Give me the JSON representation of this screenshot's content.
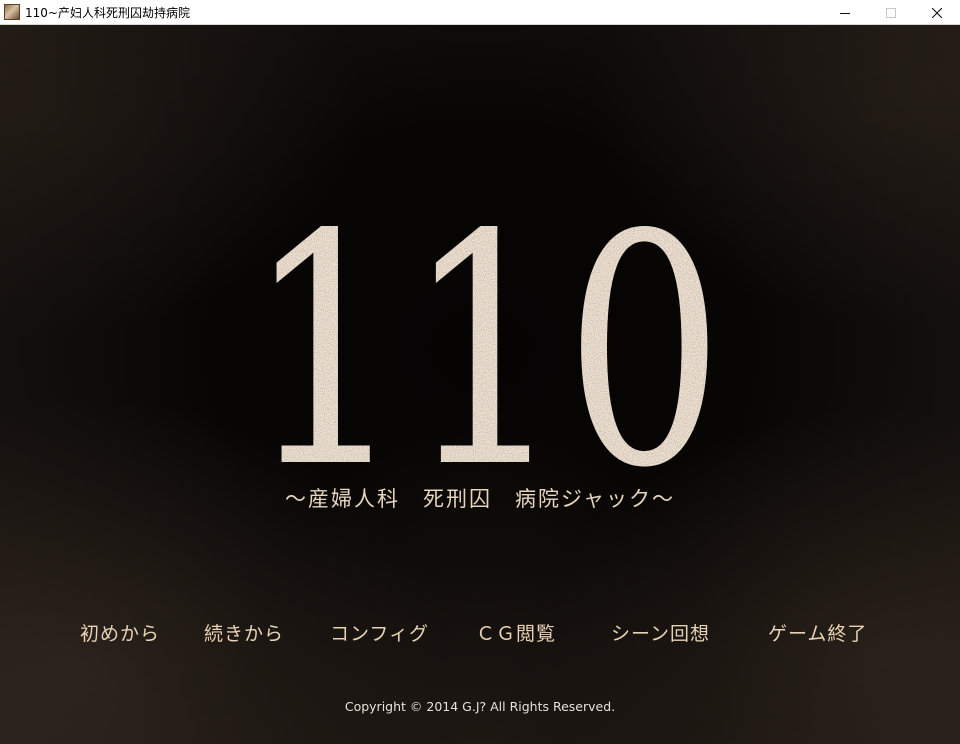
{
  "window": {
    "title": "110~产妇人科死刑囚劫持病院",
    "controls": {
      "minimize": "—",
      "maximize": "□",
      "close": "✕"
    }
  },
  "game": {
    "logo_text": "110",
    "subtitle": "～産婦人科　死刑囚　病院ジャック～",
    "menu": [
      {
        "label": "初めから"
      },
      {
        "label": "続きから"
      },
      {
        "label": "コンフィグ"
      },
      {
        "label": "ＣＧ閲覧"
      },
      {
        "label": "シーン回想"
      },
      {
        "label": "ゲーム終了"
      }
    ],
    "copyright": "Copyright © 2014 G.J? All Rights Reserved."
  },
  "colors": {
    "background": "#0b0908",
    "logo": "#ece4d8",
    "logo_stain": "#8a6a4a",
    "menu_text": "#e8d2b4",
    "subtitle_text": "#e6d6bd",
    "copyright_text": "#e6e1da"
  }
}
